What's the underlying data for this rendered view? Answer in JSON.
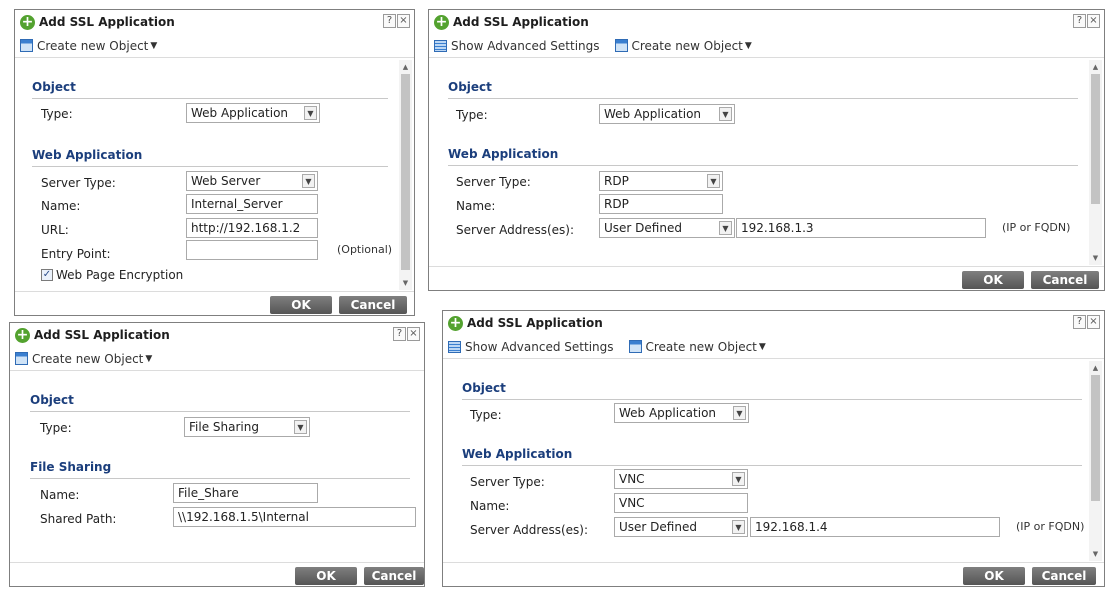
{
  "dialog_title": "Add SSL Application",
  "help_btn": "?",
  "close_btn": "×",
  "toolbar": {
    "create_new_object": "Create new Object",
    "show_advanced": "Show Advanced Settings",
    "caret": "▼"
  },
  "buttons": {
    "ok": "OK",
    "cancel": "Cancel"
  },
  "labels": {
    "object": "Object",
    "type": "Type:",
    "web_application": "Web Application",
    "server_type": "Server Type:",
    "name": "Name:",
    "url": "URL:",
    "entry_point": "Entry Point:",
    "optional": "(Optional)",
    "web_page_encryption": "Web Page Encryption",
    "server_addresses": "Server Address(es):",
    "ip_or_fqdn": "(IP or FQDN)",
    "file_sharing": "File Sharing",
    "shared_path": "Shared Path:"
  },
  "dialog1": {
    "type": "Web Application",
    "server_type": "Web Server",
    "name": "Internal_Server",
    "url": "http://192.168.1.2",
    "entry_point": "",
    "web_page_encryption_checked": true
  },
  "dialog2": {
    "type": "Web Application",
    "server_type": "RDP",
    "name": "RDP",
    "address_mode": "User Defined",
    "address": "192.168.1.3"
  },
  "dialog3": {
    "type": "File Sharing",
    "name": "File_Share",
    "shared_path": "\\\\192.168.1.5\\Internal"
  },
  "dialog4": {
    "type": "Web Application",
    "server_type": "VNC",
    "name": "VNC",
    "address_mode": "User Defined",
    "address": "192.168.1.4"
  },
  "colors": {
    "section_title": "#1b3e7c",
    "add_icon": "#53a22f",
    "button": "#666666"
  }
}
